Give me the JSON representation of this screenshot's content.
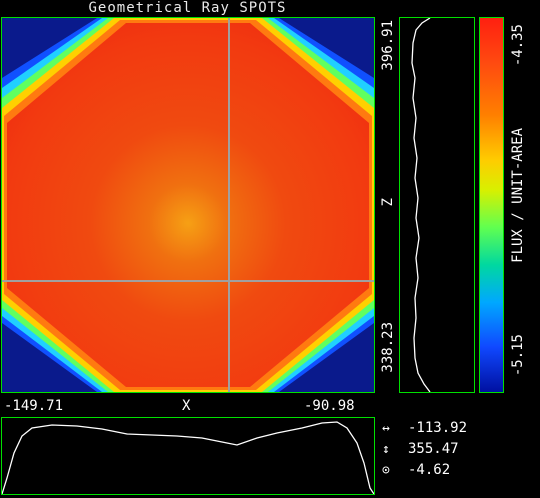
{
  "title": "Geometrical Ray SPOTS",
  "spot_plot": {
    "z_max_label": "396.91",
    "z_min_label": "338.23",
    "z_axis_label": "Z",
    "x_min_label": "-149.71",
    "x_max_label": "-90.98",
    "x_axis_label": "X"
  },
  "colorbar": {
    "max_label": "-4.35",
    "min_label": "-5.15",
    "axis_label": "FLUX / UNIT-AREA",
    "colors": [
      "#ff2010",
      "#ff8000",
      "#ffcc00",
      "#60ff50",
      "#00a8ff",
      "#0010a0"
    ]
  },
  "readouts": [
    {
      "icon": "horizontal-arrows-icon",
      "value": "-113.92"
    },
    {
      "icon": "vertical-arrows-icon",
      "value": "355.47"
    },
    {
      "icon": "target-icon",
      "value": "-4.62"
    }
  ],
  "colors": {
    "frame": "#00e000",
    "background_field": "#0a1a8c",
    "spot_core": "#f04010",
    "crosshair": "#a0a0a0"
  }
}
